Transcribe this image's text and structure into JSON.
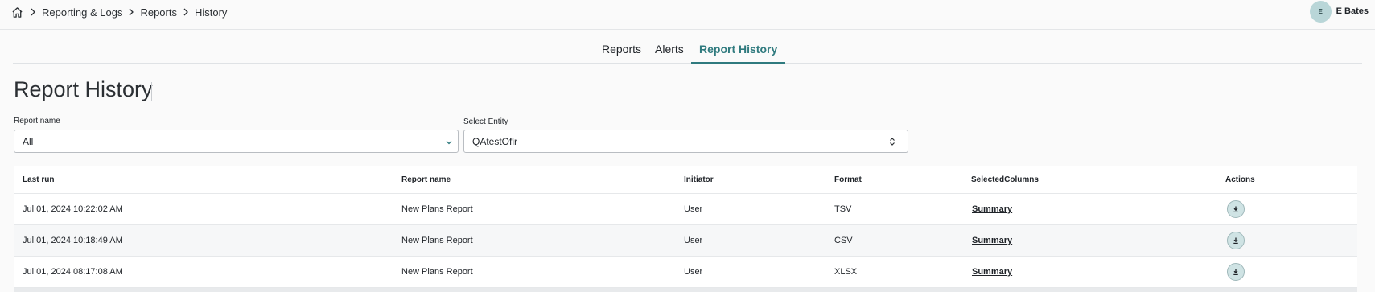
{
  "breadcrumb": {
    "home_icon": "home-icon",
    "items": [
      "Reporting & Logs",
      "Reports",
      "History"
    ]
  },
  "user": {
    "initial": "E",
    "name": "E Bates",
    "avatar_color": "#b9d6d8"
  },
  "tabs": [
    {
      "label": "Reports",
      "active": false
    },
    {
      "label": "Alerts",
      "active": false
    },
    {
      "label": "Report History",
      "active": true
    }
  ],
  "page_title": "Report History",
  "filters": {
    "report_name": {
      "label": "Report name",
      "value": "All"
    },
    "entity": {
      "label": "Select Entity",
      "value": "QAtestOfir"
    }
  },
  "table": {
    "columns": [
      "Last run",
      "Report name",
      "Initiator",
      "Format",
      "SelectedColumns",
      "Actions"
    ],
    "rows": [
      {
        "last_run": "Jul 01, 2024 10:22:02 AM",
        "report_name": "New Plans Report",
        "initiator": "User",
        "format": "TSV",
        "selected_columns": "Summary",
        "action_icon": "download-icon"
      },
      {
        "last_run": "Jul 01, 2024 10:18:49 AM",
        "report_name": "New Plans Report",
        "initiator": "User",
        "format": "CSV",
        "selected_columns": "Summary",
        "action_icon": "download-icon"
      },
      {
        "last_run": "Jul 01, 2024 08:17:08 AM",
        "report_name": "New Plans Report",
        "initiator": "User",
        "format": "XLSX",
        "selected_columns": "Summary",
        "action_icon": "download-icon"
      }
    ]
  },
  "colors": {
    "accent": "#2f7a7e",
    "download_bg": "#cfe3e4"
  }
}
